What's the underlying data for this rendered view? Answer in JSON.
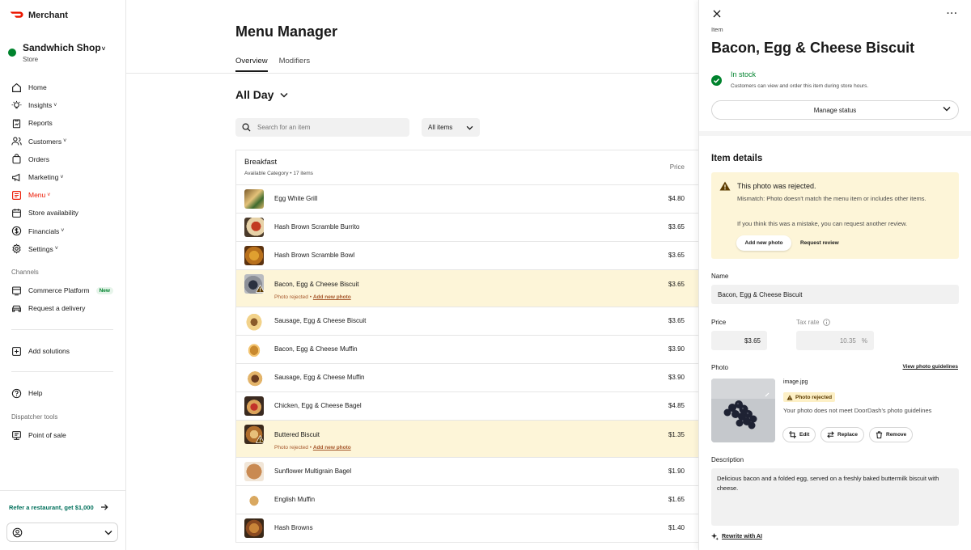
{
  "brand": {
    "name": "Merchant",
    "logo_color": "#eb1700"
  },
  "store": {
    "name": "Sandwhich Shop",
    "chevron": "˅",
    "sub": "Store"
  },
  "nav": [
    {
      "label": "Home",
      "icon": "home-icon"
    },
    {
      "label": "Insights",
      "icon": "lightbulb-icon",
      "chev": "˅"
    },
    {
      "label": "Reports",
      "icon": "clipboard-icon"
    },
    {
      "label": "Customers",
      "icon": "users-icon",
      "chev": "˅"
    },
    {
      "label": "Orders",
      "icon": "bag-icon"
    },
    {
      "label": "Marketing",
      "icon": "megaphone-icon",
      "chev": "˅"
    },
    {
      "label": "Menu",
      "icon": "menu-book-icon",
      "chev": "˅",
      "active": true
    },
    {
      "label": "Store availability",
      "icon": "calendar-icon"
    },
    {
      "label": "Financials",
      "icon": "dollar-icon",
      "chev": "˅"
    },
    {
      "label": "Settings",
      "icon": "gear-icon",
      "chev": "˅"
    }
  ],
  "channels": {
    "label": "Channels",
    "commerce": "Commerce Platform",
    "new_badge": "New",
    "delivery": "Request a delivery"
  },
  "add_solutions": "Add solutions",
  "help": "Help",
  "dispatcher": {
    "label": "Dispatcher tools",
    "pos": "Point of sale"
  },
  "refer": "Refer a restaurant, get $1,000",
  "main": {
    "title": "Menu Manager",
    "tabs": [
      "Overview",
      "Modifiers"
    ],
    "daypart": "All Day",
    "search_placeholder": "Search for an item",
    "filter": "All items",
    "category": {
      "title": "Breakfast",
      "subtitle": "Available Category • 17 items",
      "price_header": "Price"
    },
    "rejected_note": "Photo rejected",
    "add_photo_link": "Add new photo",
    "items": [
      {
        "name": "Egg White Grill",
        "price": "$4.80",
        "rejected": false
      },
      {
        "name": "Hash Brown Scramble Burrito",
        "price": "$3.65",
        "rejected": false
      },
      {
        "name": "Hash Brown Scramble Bowl",
        "price": "$3.65",
        "rejected": false
      },
      {
        "name": "Bacon, Egg & Cheese Biscuit",
        "price": "$3.65",
        "rejected": true
      },
      {
        "name": "Sausage, Egg & Cheese Biscuit",
        "price": "$3.65",
        "rejected": false
      },
      {
        "name": "Bacon, Egg & Cheese Muffin",
        "price": "$3.90",
        "rejected": false
      },
      {
        "name": "Sausage, Egg & Cheese Muffin",
        "price": "$3.90",
        "rejected": false
      },
      {
        "name": "Chicken, Egg & Cheese Bagel",
        "price": "$4.85",
        "rejected": false
      },
      {
        "name": "Buttered Biscuit",
        "price": "$1.35",
        "rejected": true
      },
      {
        "name": "Sunflower Multigrain Bagel",
        "price": "$1.90",
        "rejected": false
      },
      {
        "name": "English Muffin",
        "price": "$1.65",
        "rejected": false
      },
      {
        "name": "Hash Browns",
        "price": "$1.40",
        "rejected": false
      }
    ]
  },
  "panel": {
    "label": "Item",
    "title": "Bacon, Egg & Cheese Biscuit",
    "stock_title": "In stock",
    "stock_sub": "Customers can view and order this item during store hours.",
    "manage": "Manage status",
    "details_heading": "Item details",
    "alert_title": "This photo was rejected.",
    "alert_body": "Mismatch: Photo doesn't match the menu item or includes other items.",
    "alert_body2": "If you think this was a mistake, you can request another review.",
    "alert_btn_add": "Add new photo",
    "alert_btn_review": "Request review",
    "name_label": "Name",
    "name_value": "Bacon, Egg & Cheese Biscuit",
    "price_label": "Price",
    "price_value": "$3.65",
    "tax_label": "Tax rate",
    "tax_value": "10.35",
    "tax_unit": "%",
    "photo_label": "Photo",
    "photo_link": "View photo guidelines",
    "file_name": "image.jpg",
    "rejected_badge": "Photo rejected",
    "rejected_text": "Your photo does not meet DoorDash's photo guidelines",
    "btn_edit": "Edit",
    "btn_replace": "Replace",
    "btn_remove": "Remove",
    "desc_label": "Description",
    "desc_value": "Delicious bacon and a folded egg, served on a freshly baked buttermilk biscuit with cheese.",
    "ai_link": "Rewrite with AI"
  }
}
